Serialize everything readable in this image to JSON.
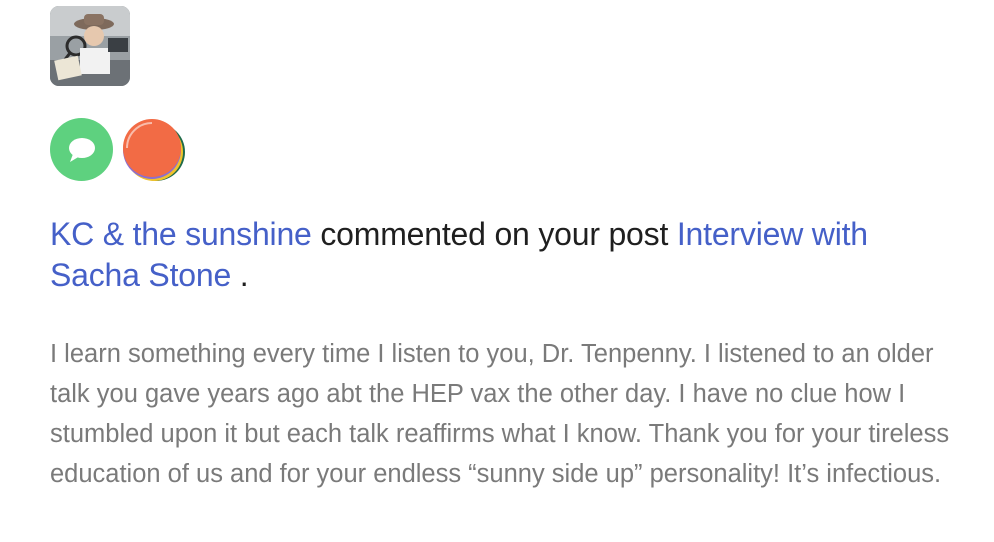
{
  "notification": {
    "actor_name": "KC & the sunshine",
    "action_text": "commented on your post",
    "post_title": "Interview with Sacha Stone",
    "end_punct": ".",
    "comment_body": "I learn something every time I listen to you, Dr. Tenpenny. I listened to an older talk you gave years ago abt the HEP vax the other day. I have no clue how I stumbled upon it but each talk reaffirms what I know. Thank you for your tireless education of us and for your endless “sunny side up” personality! It’s infectious."
  },
  "icons": {
    "avatar": "profile-photo",
    "comment_badge": "speech-bubble-icon",
    "user_badge": "user-avatar-icon"
  },
  "colors": {
    "link": "#4560c8",
    "text": "#1f1f1f",
    "comment_text": "#7a7a7a",
    "comment_badge": "#5ed17f",
    "user_badge_primary": "#f26b45"
  }
}
